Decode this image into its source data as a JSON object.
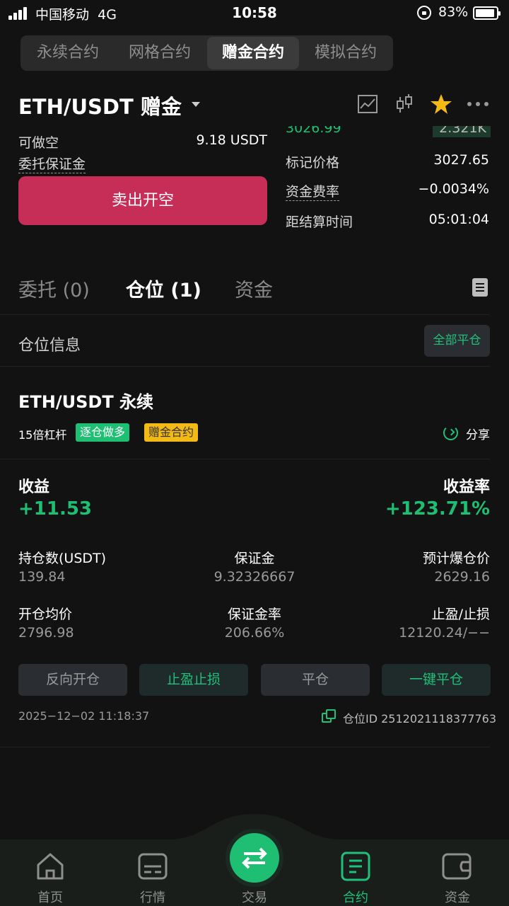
{
  "status_bar": {
    "carrier": "中国移动",
    "network": "4G",
    "time": "10:58",
    "battery": "83%"
  },
  "mode_tabs": [
    {
      "label": "永续合约",
      "active": false
    },
    {
      "label": "网格合约",
      "active": false
    },
    {
      "label": "赠金合约",
      "active": true
    },
    {
      "label": "模拟合约",
      "active": false
    }
  ],
  "header": {
    "pair": "ETH/USDT 赠金",
    "icons": [
      "line-chart-icon",
      "candlestick-icon",
      "star-icon",
      "more-icon"
    ]
  },
  "order_panel": {
    "short_label": "可做空",
    "short_value": "9.18 USDT",
    "margin_label": "委托保证金",
    "sell_button": "卖出开空"
  },
  "market_info": {
    "cut_price": "3026.99",
    "cut_amount": "2.321K",
    "mark_price_label": "标记价格",
    "mark_price": "3027.65",
    "funding_rate_label": "资金费率",
    "funding_rate": "−0.0034%",
    "settle_label": "距结算时间",
    "settle_time": "05:01:04"
  },
  "section_tabs": [
    {
      "label": "委托 (0)",
      "active": false
    },
    {
      "label": "仓位 (1)",
      "active": true
    },
    {
      "label": "资金",
      "active": false
    }
  ],
  "position_info": {
    "title": "仓位信息",
    "close_all": "全部平仓"
  },
  "position": {
    "pair": "ETH/USDT 永续",
    "leverage": "15倍杠杆",
    "badge_mode": "逐仓做多",
    "badge_type": "赠金合约",
    "share": "分享",
    "pnl_label": "收益",
    "pnl_value": "+11.53",
    "roe_label": "收益率",
    "roe_value": "+123.71%",
    "stats": [
      {
        "label": "持仓数(USDT)",
        "value": "139.84"
      },
      {
        "label": "保证金",
        "value": "9.32326667"
      },
      {
        "label": "预计爆仓价",
        "value": "2629.16"
      },
      {
        "label": "开仓均价",
        "value": "2796.98"
      },
      {
        "label": "保证金率",
        "value": "206.66%"
      },
      {
        "label": "止盈/止损",
        "value": "12120.24/−−"
      }
    ],
    "actions": [
      {
        "label": "反向开仓",
        "style": "gray"
      },
      {
        "label": "止盈止损",
        "style": "green"
      },
      {
        "label": "平仓",
        "style": "gray"
      },
      {
        "label": "一键平仓",
        "style": "green"
      }
    ],
    "timestamp": "2025−12−02 11:18:37",
    "position_id": "仓位ID 2512021118377763"
  },
  "bottom_nav": [
    {
      "label": "首页",
      "icon": "home-icon",
      "active": false
    },
    {
      "label": "行情",
      "icon": "market-icon",
      "active": false
    },
    {
      "label": "交易",
      "icon": "swap-icon",
      "active": false
    },
    {
      "label": "合约",
      "icon": "contract-icon",
      "active": true
    },
    {
      "label": "资金",
      "icon": "wallet-icon",
      "active": false
    }
  ],
  "colors": {
    "background": "#121212",
    "accent_green": "#1fbf73",
    "sell_red": "#c62e57",
    "star_yellow": "#f3b914"
  }
}
